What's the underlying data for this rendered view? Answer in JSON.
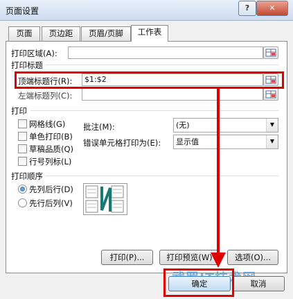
{
  "window": {
    "title": "页面设置",
    "help": "?",
    "close": "✕"
  },
  "tabs": [
    {
      "label": "页面"
    },
    {
      "label": "页边距"
    },
    {
      "label": "页眉/页脚"
    },
    {
      "label": "工作表",
      "selected": true
    }
  ],
  "print_area": {
    "label": "打印区域(A):",
    "value": ""
  },
  "print_titles": {
    "heading": "打印标题",
    "rows_label": "顶端标题行(R):",
    "rows_value": "$1:$2",
    "cols_label": "左端标题列(C):",
    "cols_value": ""
  },
  "print": {
    "heading": "打印",
    "gridlines": "网格线(G)",
    "mono": "单色打印(B)",
    "draft": "草稿品质(Q)",
    "headings": "行号列标(L)",
    "comments_label": "批注(M):",
    "comments_value": "(无)",
    "errors_label": "错误单元格打印为(E):",
    "errors_value": "显示值"
  },
  "order": {
    "heading": "打印顺序",
    "down_then_over": "先列后行(D)",
    "over_then_down": "先行后列(V)",
    "selected": "down_then_over"
  },
  "buttons": {
    "print": "打印(P)...",
    "preview": "打印预览(W)",
    "options": "选项(O)...",
    "ok": "确定",
    "cancel": "取消"
  },
  "watermark": "武罗IT技术网",
  "colors": {
    "highlight": "#e00000",
    "accent": "#1c6fc5",
    "watermark": "#1e7fd0"
  }
}
